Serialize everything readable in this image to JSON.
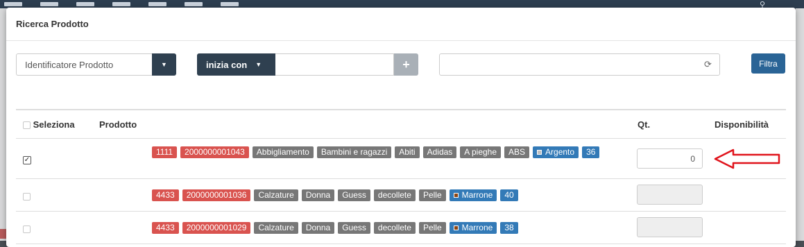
{
  "modal": {
    "title": "Ricerca Prodotto"
  },
  "filters": {
    "field_selected": "Identificatore Prodotto",
    "mode_label": "inizia con",
    "text_value": "",
    "search_value": "",
    "filter_button": "Filtra"
  },
  "table": {
    "headers": {
      "select": "Seleziona",
      "product": "Prodotto",
      "qty": "Qt.",
      "availability": "Disponibilità"
    },
    "rows": [
      {
        "selected": true,
        "tags": [
          {
            "text": "1111",
            "color": "red"
          },
          {
            "text": "2000000001043",
            "color": "red"
          },
          {
            "text": "Abbigliamento",
            "color": "gray"
          },
          {
            "text": "Bambini e ragazzi",
            "color": "gray"
          },
          {
            "text": "Abiti",
            "color": "gray"
          },
          {
            "text": "Adidas",
            "color": "gray"
          },
          {
            "text": "A pieghe",
            "color": "gray"
          },
          {
            "text": "ABS",
            "color": "gray"
          },
          {
            "text": "Argento",
            "color": "blue",
            "swatch": "#c0c0c0"
          },
          {
            "text": "36",
            "color": "blue"
          }
        ],
        "qty": "0",
        "qty_enabled": true
      },
      {
        "selected": false,
        "tags": [
          {
            "text": "4433",
            "color": "red"
          },
          {
            "text": "2000000001036",
            "color": "red"
          },
          {
            "text": "Calzature",
            "color": "gray"
          },
          {
            "text": "Donna",
            "color": "gray"
          },
          {
            "text": "Guess",
            "color": "gray"
          },
          {
            "text": "decollete",
            "color": "gray"
          },
          {
            "text": "Pelle",
            "color": "gray"
          },
          {
            "text": "Marrone",
            "color": "blue",
            "swatch": "#8b4513"
          },
          {
            "text": "40",
            "color": "blue"
          }
        ],
        "qty": "",
        "qty_enabled": false
      },
      {
        "selected": false,
        "tags": [
          {
            "text": "4433",
            "color": "red"
          },
          {
            "text": "2000000001029",
            "color": "red"
          },
          {
            "text": "Calzature",
            "color": "gray"
          },
          {
            "text": "Donna",
            "color": "gray"
          },
          {
            "text": "Guess",
            "color": "gray"
          },
          {
            "text": "decollete",
            "color": "gray"
          },
          {
            "text": "Pelle",
            "color": "gray"
          },
          {
            "text": "Marrone",
            "color": "blue",
            "swatch": "#8b4513"
          },
          {
            "text": "38",
            "color": "blue"
          }
        ],
        "qty": "",
        "qty_enabled": false
      }
    ]
  },
  "colors": {
    "dark_button": "#2f4050",
    "primary_button": "#2a6496",
    "tag_red": "#d9534f",
    "tag_gray": "#777777",
    "tag_blue": "#337ab7",
    "arrow": "#e0131b"
  },
  "icons": [
    "caret-down-icon",
    "plus-icon",
    "refresh-icon",
    "checkbox-icon",
    "red-arrow-annotation"
  ]
}
